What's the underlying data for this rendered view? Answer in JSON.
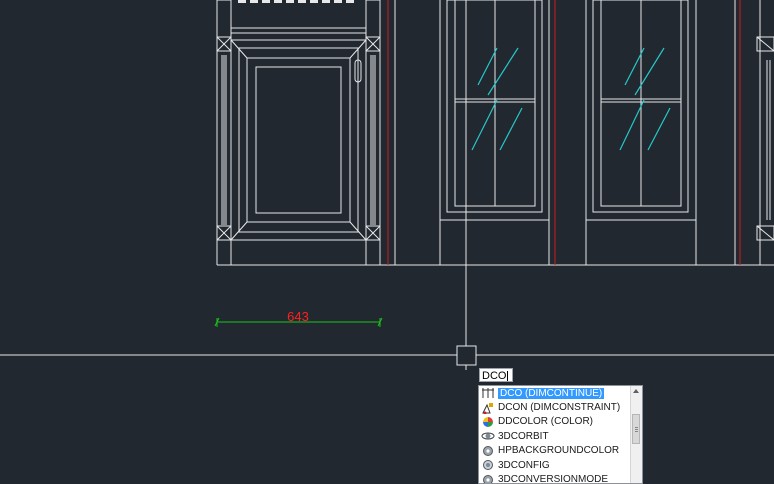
{
  "drawing": {
    "dimension_value": "643",
    "dimension_color": "#ff2020",
    "dimension_line_color": "#19c519",
    "linework_color": "#e8e8e8",
    "centerline_color": "#d11b1b",
    "glass_hatch_color": "#27c8c8",
    "background_color": "#212830"
  },
  "command": {
    "input_value": "DCO"
  },
  "autocomplete": {
    "items": [
      {
        "label": "DCO (DIMCONTINUE)",
        "icon": "dimcontinue-icon",
        "selected": true
      },
      {
        "label": "DCON (DIMCONSTRAINT)",
        "icon": "dimconstraint-icon",
        "selected": false
      },
      {
        "label": "DDCOLOR (COLOR)",
        "icon": "color-wheel-icon",
        "selected": false
      },
      {
        "label": "3DCORBIT",
        "icon": "orbit-icon",
        "selected": false
      },
      {
        "label": "HPBACKGROUNDCOLOR",
        "icon": "gear-icon",
        "selected": false
      },
      {
        "label": "3DCONFIG",
        "icon": "config-icon",
        "selected": false
      },
      {
        "label": "3DCONVERSIONMODE",
        "icon": "gear-icon",
        "selected": false
      }
    ]
  }
}
